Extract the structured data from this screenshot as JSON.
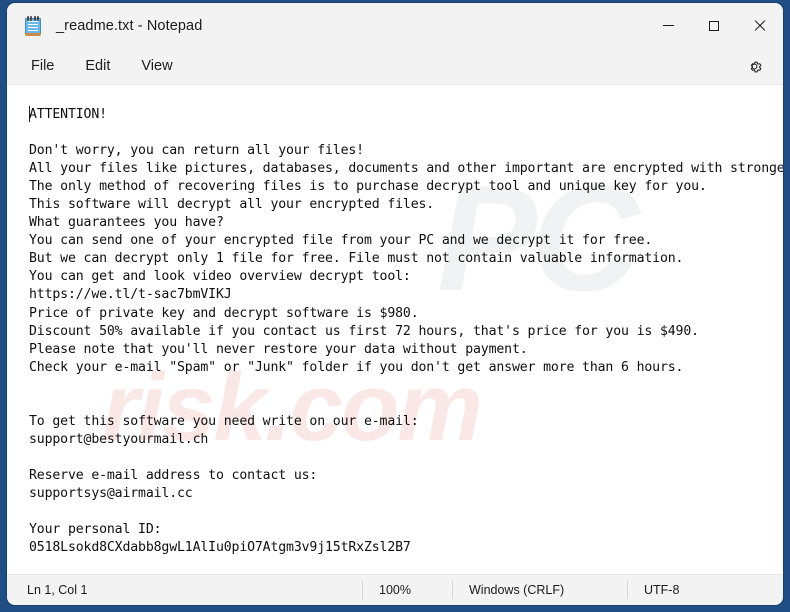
{
  "window": {
    "title": "_readme.txt - Notepad",
    "icon": "notepad-icon",
    "controls": {
      "minimize": "minimize-icon",
      "maximize": "maximize-icon",
      "close": "close-icon"
    }
  },
  "menubar": {
    "items": [
      {
        "label": "File"
      },
      {
        "label": "Edit"
      },
      {
        "label": "View"
      }
    ],
    "settings_icon": "gear-icon"
  },
  "editor": {
    "content": "ATTENTION!\n\nDon't worry, you can return all your files!\nAll your files like pictures, databases, documents and other important are encrypted with strongest encryption and unique key.\nThe only method of recovering files is to purchase decrypt tool and unique key for you.\nThis software will decrypt all your encrypted files.\nWhat guarantees you have?\nYou can send one of your encrypted file from your PC and we decrypt it for free.\nBut we can decrypt only 1 file for free. File must not contain valuable information.\nYou can get and look video overview decrypt tool:\nhttps://we.tl/t-sac7bmVIKJ\nPrice of private key and decrypt software is $980.\nDiscount 50% available if you contact us first 72 hours, that's price for you is $490.\nPlease note that you'll never restore your data without payment.\nCheck your e-mail \"Spam\" or \"Junk\" folder if you don't get answer more than 6 hours.\n\n\nTo get this software you need write on our e-mail:\nsupport@bestyourmail.ch\n\nReserve e-mail address to contact us:\nsupportsys@airmail.cc\n\nYour personal ID:\n0518Lsokd8CXdabb8gwL1AlIu0piO7Atgm3v9j15tRxZsl2B7",
    "watermark_primary": "PC",
    "watermark_secondary": "risk.com"
  },
  "statusbar": {
    "line_col": "Ln 1, Col 1",
    "zoom": "100%",
    "line_ending": "Windows (CRLF)",
    "encoding": "UTF-8"
  },
  "colors": {
    "desktop": "#1f4d84",
    "chrome": "#f3f3f3",
    "editor_bg": "#ffffff",
    "text": "#0f0f0f"
  }
}
